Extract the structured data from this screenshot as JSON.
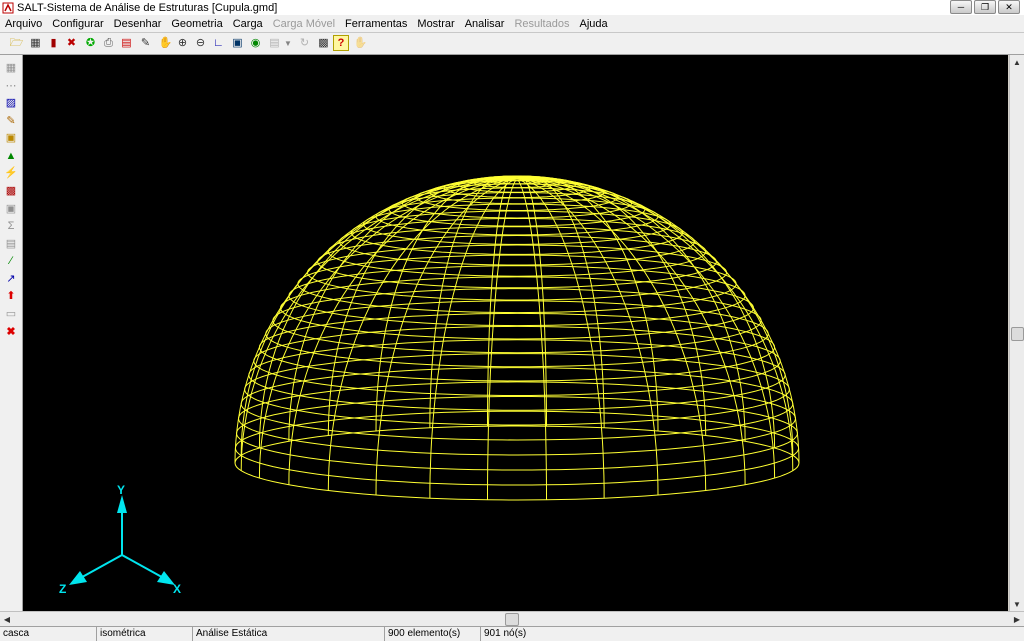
{
  "window": {
    "title": "SALT-Sistema de Análise de Estruturas [Cupula.gmd]",
    "controls": [
      "minimize",
      "restore",
      "close"
    ]
  },
  "menu": [
    {
      "label": "Arquivo",
      "enabled": true
    },
    {
      "label": "Configurar",
      "enabled": true
    },
    {
      "label": "Desenhar",
      "enabled": true
    },
    {
      "label": "Geometria",
      "enabled": true
    },
    {
      "label": "Carga",
      "enabled": true
    },
    {
      "label": "Carga Móvel",
      "enabled": false
    },
    {
      "label": "Ferramentas",
      "enabled": true
    },
    {
      "label": "Mostrar",
      "enabled": true
    },
    {
      "label": "Analisar",
      "enabled": true
    },
    {
      "label": "Resultados",
      "enabled": false
    },
    {
      "label": "Ajuda",
      "enabled": true
    }
  ],
  "toolbar": [
    {
      "icon": "open-folder-icon",
      "enabled": true
    },
    {
      "icon": "calculator-icon",
      "enabled": true
    },
    {
      "icon": "book-icon",
      "enabled": true
    },
    {
      "icon": "tools-icon",
      "enabled": true
    },
    {
      "icon": "running-man-icon",
      "enabled": true
    },
    {
      "icon": "printer-icon",
      "enabled": true
    },
    {
      "icon": "print-preview-icon",
      "enabled": true
    },
    {
      "icon": "pencil-icon",
      "enabled": true
    },
    {
      "icon": "pan-hand-icon",
      "enabled": true
    },
    {
      "icon": "zoom-in-icon",
      "enabled": true
    },
    {
      "icon": "zoom-out-icon",
      "enabled": true
    },
    {
      "icon": "axes-icon",
      "enabled": true
    },
    {
      "icon": "monitor-icon",
      "enabled": true
    },
    {
      "icon": "target-icon",
      "enabled": true
    },
    {
      "icon": "chart-icon",
      "enabled": false
    },
    {
      "icon": "dropdown-arrow-icon",
      "enabled": false
    },
    {
      "icon": "rotate-icon",
      "enabled": false
    },
    {
      "icon": "image-icon",
      "enabled": true
    },
    {
      "icon": "export-icon",
      "enabled": true
    },
    {
      "icon": "help-icon",
      "enabled": true
    },
    {
      "icon": "stop-hand-icon",
      "enabled": false
    }
  ],
  "left_toolbar": [
    {
      "icon": "grid-icon",
      "enabled": false
    },
    {
      "icon": "node-icon",
      "enabled": false
    },
    {
      "icon": "element-icon",
      "enabled": true
    },
    {
      "icon": "edit-icon",
      "enabled": true
    },
    {
      "icon": "property-icon",
      "enabled": true
    },
    {
      "icon": "support-icon",
      "enabled": true
    },
    {
      "icon": "lightning-icon",
      "enabled": true
    },
    {
      "icon": "load-icon",
      "enabled": true
    },
    {
      "icon": "save-icon",
      "enabled": false
    },
    {
      "icon": "sum-icon",
      "enabled": false
    },
    {
      "icon": "table-icon",
      "enabled": false
    },
    {
      "icon": "line-icon",
      "enabled": true
    },
    {
      "icon": "vector-icon",
      "enabled": true
    },
    {
      "icon": "red-arrow-up-icon",
      "enabled": true
    },
    {
      "icon": "copy-icon",
      "enabled": false
    },
    {
      "icon": "delete-x-icon",
      "enabled": true
    }
  ],
  "viewport": {
    "background": "#000000",
    "mesh_color": "#ffff33",
    "axis_color": "#00e5ee",
    "axes": {
      "x": "X",
      "y": "Y",
      "z": "Z"
    }
  },
  "status": [
    "casca",
    "isométrica",
    "Análise Estática",
    "900 elemento(s)",
    "901 nó(s)"
  ],
  "colors": {
    "chrome": "#f0f0f0",
    "frame": "#d4d0c8"
  }
}
